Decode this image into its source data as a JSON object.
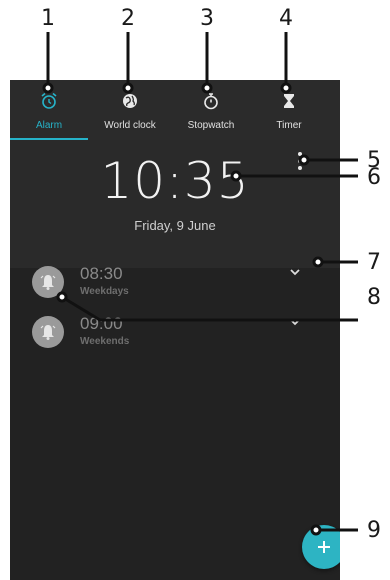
{
  "callouts": [
    "1",
    "2",
    "3",
    "4",
    "5",
    "6",
    "7",
    "8",
    "9"
  ],
  "tabs": [
    {
      "label": "Alarm",
      "icon": "alarm-clock-icon",
      "active": true
    },
    {
      "label": "World clock",
      "icon": "globe-icon",
      "active": false
    },
    {
      "label": "Stopwatch",
      "icon": "stopwatch-icon",
      "active": false
    },
    {
      "label": "Timer",
      "icon": "hourglass-icon",
      "active": false
    }
  ],
  "clock": {
    "time": "10:35",
    "date": "Friday, 9 June"
  },
  "alarms": [
    {
      "time": "08:30",
      "days": "Weekdays",
      "icon": "alarm-bell-icon"
    },
    {
      "time": "09:00",
      "days": "Weekends",
      "icon": "alarm-bell-icon"
    }
  ],
  "colors": {
    "accent": "#26b3c9",
    "background": "#222222",
    "fab": "#2db4c3"
  },
  "icons": {
    "overflow": "overflow-menu-icon",
    "expand": "chevron-down-icon",
    "fab": "plus-icon"
  }
}
